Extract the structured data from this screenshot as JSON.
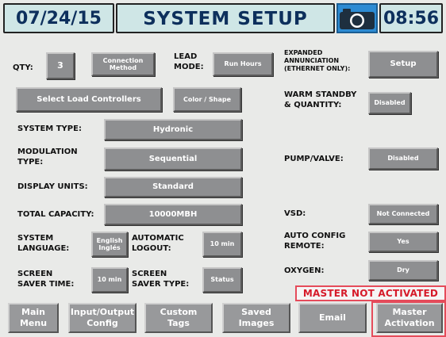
{
  "header": {
    "date": "07/24/15",
    "title": "SYSTEM SETUP",
    "camera_icon": "camera-icon",
    "time": "08:56"
  },
  "qty": {
    "label": "QTY:",
    "value": "3"
  },
  "connection_method": {
    "label": "Connection\nMethod"
  },
  "lead_mode": {
    "label": "LEAD\nMODE:",
    "value": "Run Hours"
  },
  "expanded_annunciation": {
    "label": "EXPANDED\nANNUNCIATION\n(ETHERNET ONLY):",
    "button": "Setup"
  },
  "select_load_controllers": "Select Load Controllers",
  "color_shape": "Color / Shape",
  "warm_standby": {
    "label": "WARM STANDBY\n& QUANTITY:",
    "value": "Disabled"
  },
  "system_type": {
    "label": "SYSTEM TYPE:",
    "value": "Hydronic"
  },
  "modulation_type": {
    "label": "MODULATION\nTYPE:",
    "value": "Sequential"
  },
  "pump_valve": {
    "label": "PUMP/VALVE:",
    "value": "Disabled"
  },
  "display_units": {
    "label": "DISPLAY UNITS:",
    "value": "Standard"
  },
  "total_capacity": {
    "label": "TOTAL CAPACITY:",
    "value": "10000MBH"
  },
  "vsd": {
    "label": "VSD:",
    "value": "Not Connected"
  },
  "system_language": {
    "label": "SYSTEM\nLANGUAGE:",
    "value": "English\nInglés"
  },
  "automatic_logout": {
    "label": "AUTOMATIC\nLOGOUT:",
    "value": "10 min"
  },
  "auto_config_remote": {
    "label": "AUTO CONFIG\nREMOTE:",
    "value": "Yes"
  },
  "screen_saver_time": {
    "label": "SCREEN\nSAVER TIME:",
    "value": "10 min"
  },
  "screen_saver_type": {
    "label": "SCREEN\nSAVER TYPE:",
    "value": "Status"
  },
  "oxygen": {
    "label": "OXYGEN:",
    "value": "Dry"
  },
  "alert": "MASTER NOT ACTIVATED",
  "nav": [
    "Main\nMenu",
    "Input/Output\nConfig",
    "Custom\nTags",
    "Saved\nImages",
    "Email",
    "Master\nActivation"
  ]
}
